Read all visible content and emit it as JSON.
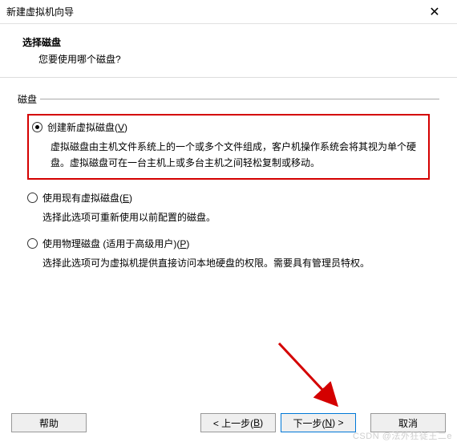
{
  "window": {
    "title": "新建虚拟机向导"
  },
  "header": {
    "title": "选择磁盘",
    "subtitle": "您要使用哪个磁盘?"
  },
  "fieldset": {
    "label": "磁盘"
  },
  "options": {
    "create": {
      "label_pre": "创建新虚拟磁盘(",
      "label_key": "V",
      "label_post": ")",
      "desc": "虚拟磁盘由主机文件系统上的一个或多个文件组成，客户机操作系统会将其视为单个硬盘。虚拟磁盘可在一台主机上或多台主机之间轻松复制或移动。"
    },
    "existing": {
      "label_pre": "使用现有虚拟磁盘(",
      "label_key": "E",
      "label_post": ")",
      "desc": "选择此选项可重新使用以前配置的磁盘。"
    },
    "physical": {
      "label_pre": "使用物理磁盘 (适用于高级用户)(",
      "label_key": "P",
      "label_post": ")",
      "desc": "选择此选项可为虚拟机提供直接访问本地硬盘的权限。需要具有管理员特权。"
    }
  },
  "buttons": {
    "help": "帮助",
    "back_pre": "< 上一步(",
    "back_key": "B",
    "back_post": ")",
    "next_pre": "下一步(",
    "next_key": "N",
    "next_post": ") >",
    "cancel": "取消"
  },
  "watermark": "CSDN @法外狂徒王二e"
}
